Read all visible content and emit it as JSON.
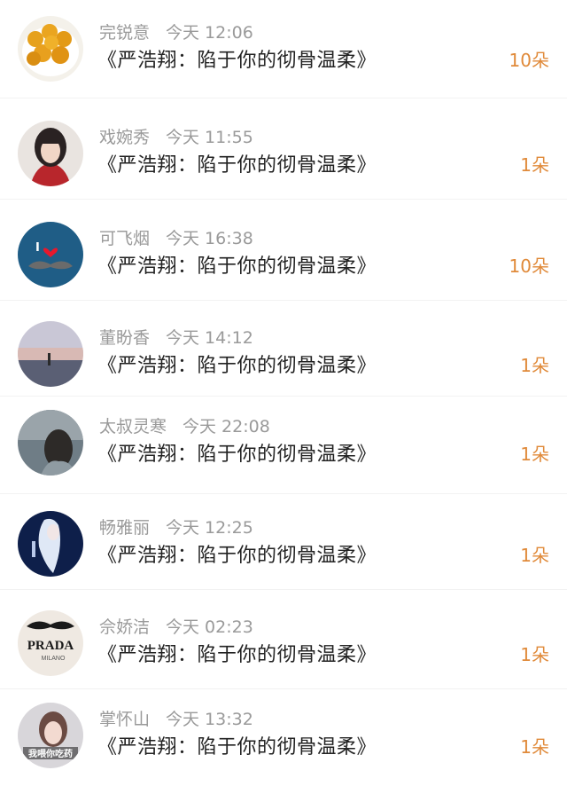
{
  "colors": {
    "count": "#e08a3a",
    "meta": "#9a9a9a",
    "title": "#222222"
  },
  "items": [
    {
      "name": "完锐意",
      "time": "今天 12:06",
      "title": "《严浩翔：陷于你的彻骨温柔》",
      "count": "10朵",
      "avatar": "orange-balls-icon"
    },
    {
      "name": "戏婉秀",
      "time": "今天 11:55",
      "title": "《严浩翔：陷于你的彻骨温柔》",
      "count": "1朵",
      "avatar": "girl-portrait-icon"
    },
    {
      "name": "可飞烟",
      "time": "今天 16:38",
      "title": "《严浩翔：陷于你的彻骨温柔》",
      "count": "10朵",
      "avatar": "mustache-heart-icon"
    },
    {
      "name": "董盼香",
      "time": "今天 14:12",
      "title": "《严浩翔：陷于你的彻骨温柔》",
      "count": "1朵",
      "avatar": "sunset-lake-icon"
    },
    {
      "name": "太叔灵寒",
      "time": "今天 22:08",
      "title": "《严浩翔：陷于你的彻骨温柔》",
      "count": "1朵",
      "avatar": "girl-back-icon"
    },
    {
      "name": "畅雅丽",
      "time": "今天 12:25",
      "title": "《严浩翔：陷于你的彻骨温柔》",
      "count": "1朵",
      "avatar": "anime-girl-icon"
    },
    {
      "name": "佘娇洁",
      "time": "今天 02:23",
      "title": "《严浩翔：陷于你的彻骨温柔》",
      "count": "1朵",
      "avatar": "prada-logo-icon",
      "avatar_text": "PRADA",
      "avatar_subtext": "MILANO"
    },
    {
      "name": "掌怀山",
      "time": "今天 13:32",
      "title": "《严浩翔：陷于你的彻骨温柔》",
      "count": "1朵",
      "avatar": "girl-caption-icon",
      "avatar_text": "我喂你吃药"
    }
  ]
}
